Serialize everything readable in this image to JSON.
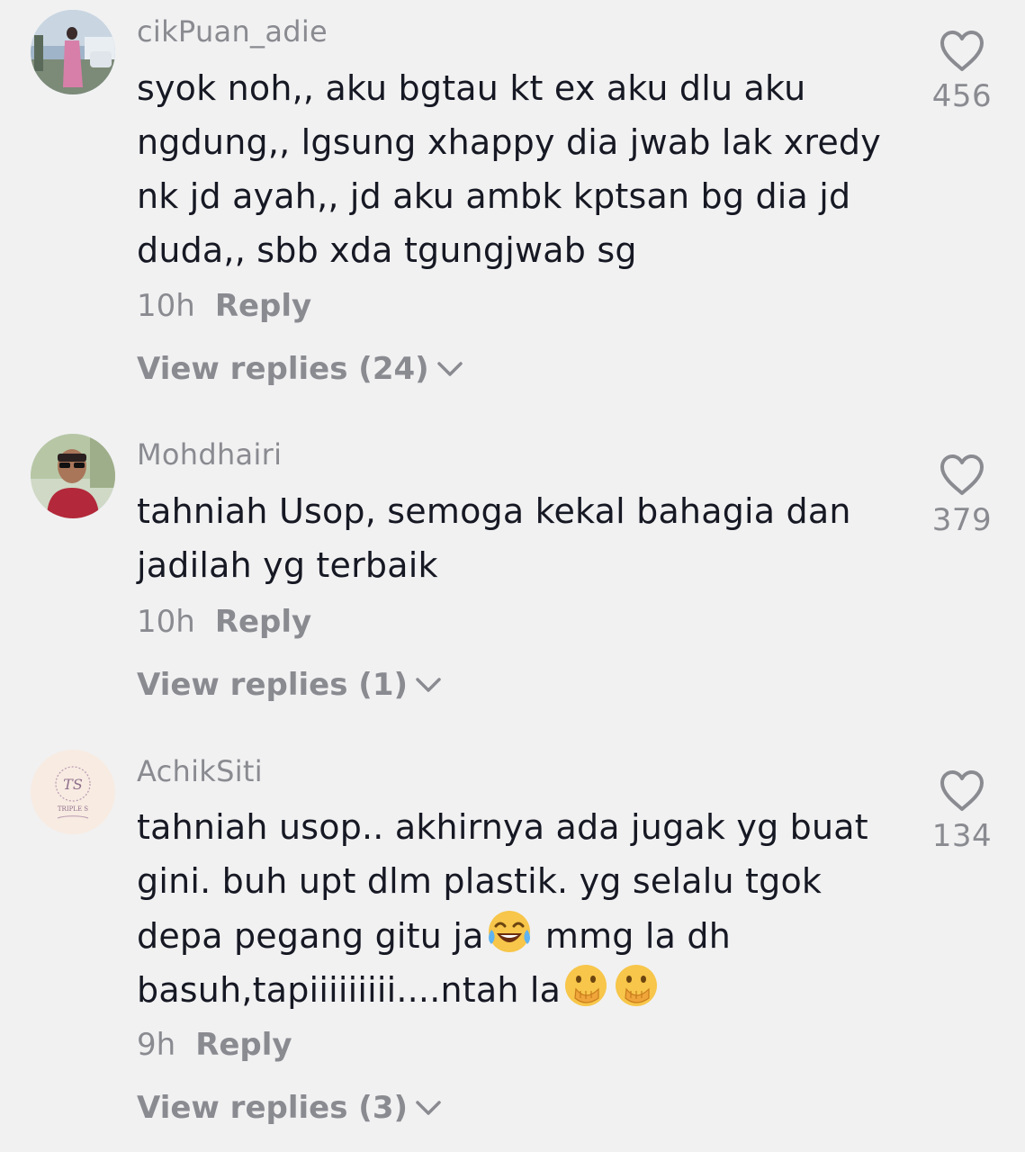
{
  "comments": [
    {
      "username": "cikPuan_adie",
      "lines": [
        "syok noh,, aku bgtau kt ex aku dlu aku",
        "ngdung,, lgsung xhappy dia jwab lak xredy",
        "nk jd ayah,, jd aku ambk kptsan bg dia jd",
        "duda,, sbb xda tgungjwab sg"
      ],
      "time": "10h",
      "reply_label": "Reply",
      "view_replies": "View replies (24)",
      "likes": "456"
    },
    {
      "username": "Mohdhairi",
      "lines": [
        "tahniah Usop, semoga kekal bahagia dan",
        "jadilah yg terbaik"
      ],
      "time": "10h",
      "reply_label": "Reply",
      "view_replies": "View replies (1)",
      "likes": "379"
    },
    {
      "username": "AchikSiti",
      "lines": [
        "tahniah usop.. akhirnya ada jugak yg buat",
        "gini. buh upt dlm plastik. yg selalu tgok"
      ],
      "line3_before": "depa pegang gitu ja",
      "line3_after": " mmg la dh",
      "line4_before": "basuh,tapiiiiiiiii....ntah la",
      "emoji_names": [
        "face-with-tears-of-joy-emoji",
        "face-with-hand-over-mouth-emoji"
      ],
      "time": "9h",
      "reply_label": "Reply",
      "view_replies": "View replies (3)",
      "likes": "134",
      "avatar_logo_text": "TS",
      "avatar_logo_subtext": "TRIPLE S"
    }
  ],
  "icons": {
    "like": "heart-outline-icon",
    "expand": "chevron-down-icon"
  },
  "colors": {
    "background": "#f1f1f2",
    "text": "#161823",
    "secondary": "#8a8b91"
  }
}
